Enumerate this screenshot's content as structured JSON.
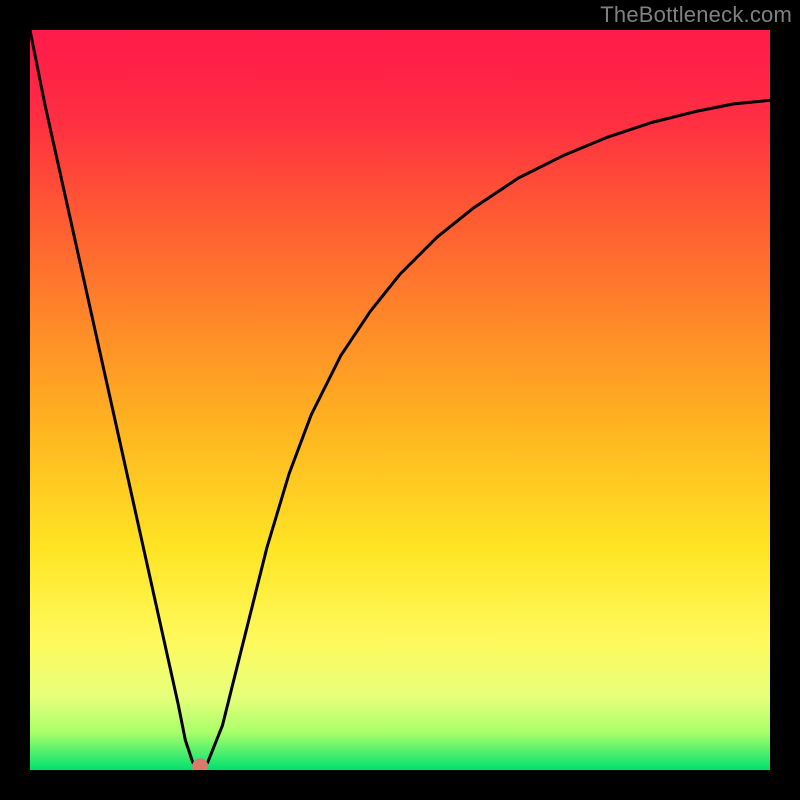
{
  "watermark": "TheBottleneck.com",
  "chart_data": {
    "type": "line",
    "title": "",
    "xlabel": "",
    "ylabel": "",
    "xlim": [
      0,
      100
    ],
    "ylim": [
      0,
      100
    ],
    "grid": false,
    "legend": false,
    "background_gradient": {
      "stops": [
        {
          "offset": 0.0,
          "color": "#ff1a4a"
        },
        {
          "offset": 0.12,
          "color": "#ff2e42"
        },
        {
          "offset": 0.25,
          "color": "#ff5a33"
        },
        {
          "offset": 0.4,
          "color": "#ff8a28"
        },
        {
          "offset": 0.55,
          "color": "#ffb820"
        },
        {
          "offset": 0.7,
          "color": "#ffe424"
        },
        {
          "offset": 0.82,
          "color": "#fff95a"
        },
        {
          "offset": 0.9,
          "color": "#e8ff7a"
        },
        {
          "offset": 0.95,
          "color": "#a7ff6a"
        },
        {
          "offset": 1.0,
          "color": "#00e070"
        }
      ]
    },
    "series": [
      {
        "name": "bottleneck-curve",
        "color": "#000000",
        "x": [
          0,
          2,
          4,
          6,
          8,
          10,
          12,
          14,
          16,
          18,
          20,
          21,
          22,
          23,
          24,
          26,
          28,
          30,
          32,
          35,
          38,
          42,
          46,
          50,
          55,
          60,
          66,
          72,
          78,
          84,
          90,
          95,
          100
        ],
        "y": [
          100,
          90,
          81,
          72,
          63,
          54,
          45,
          36,
          27,
          18,
          9,
          4,
          1,
          0.5,
          1,
          6,
          14,
          22,
          30,
          40,
          48,
          56,
          62,
          67,
          72,
          76,
          80,
          83,
          85.5,
          87.5,
          89,
          90,
          90.5
        ]
      }
    ],
    "marker": {
      "name": "current-point",
      "x": 23,
      "y": 0.5,
      "color": "#d97a6c",
      "radius": 8
    }
  }
}
